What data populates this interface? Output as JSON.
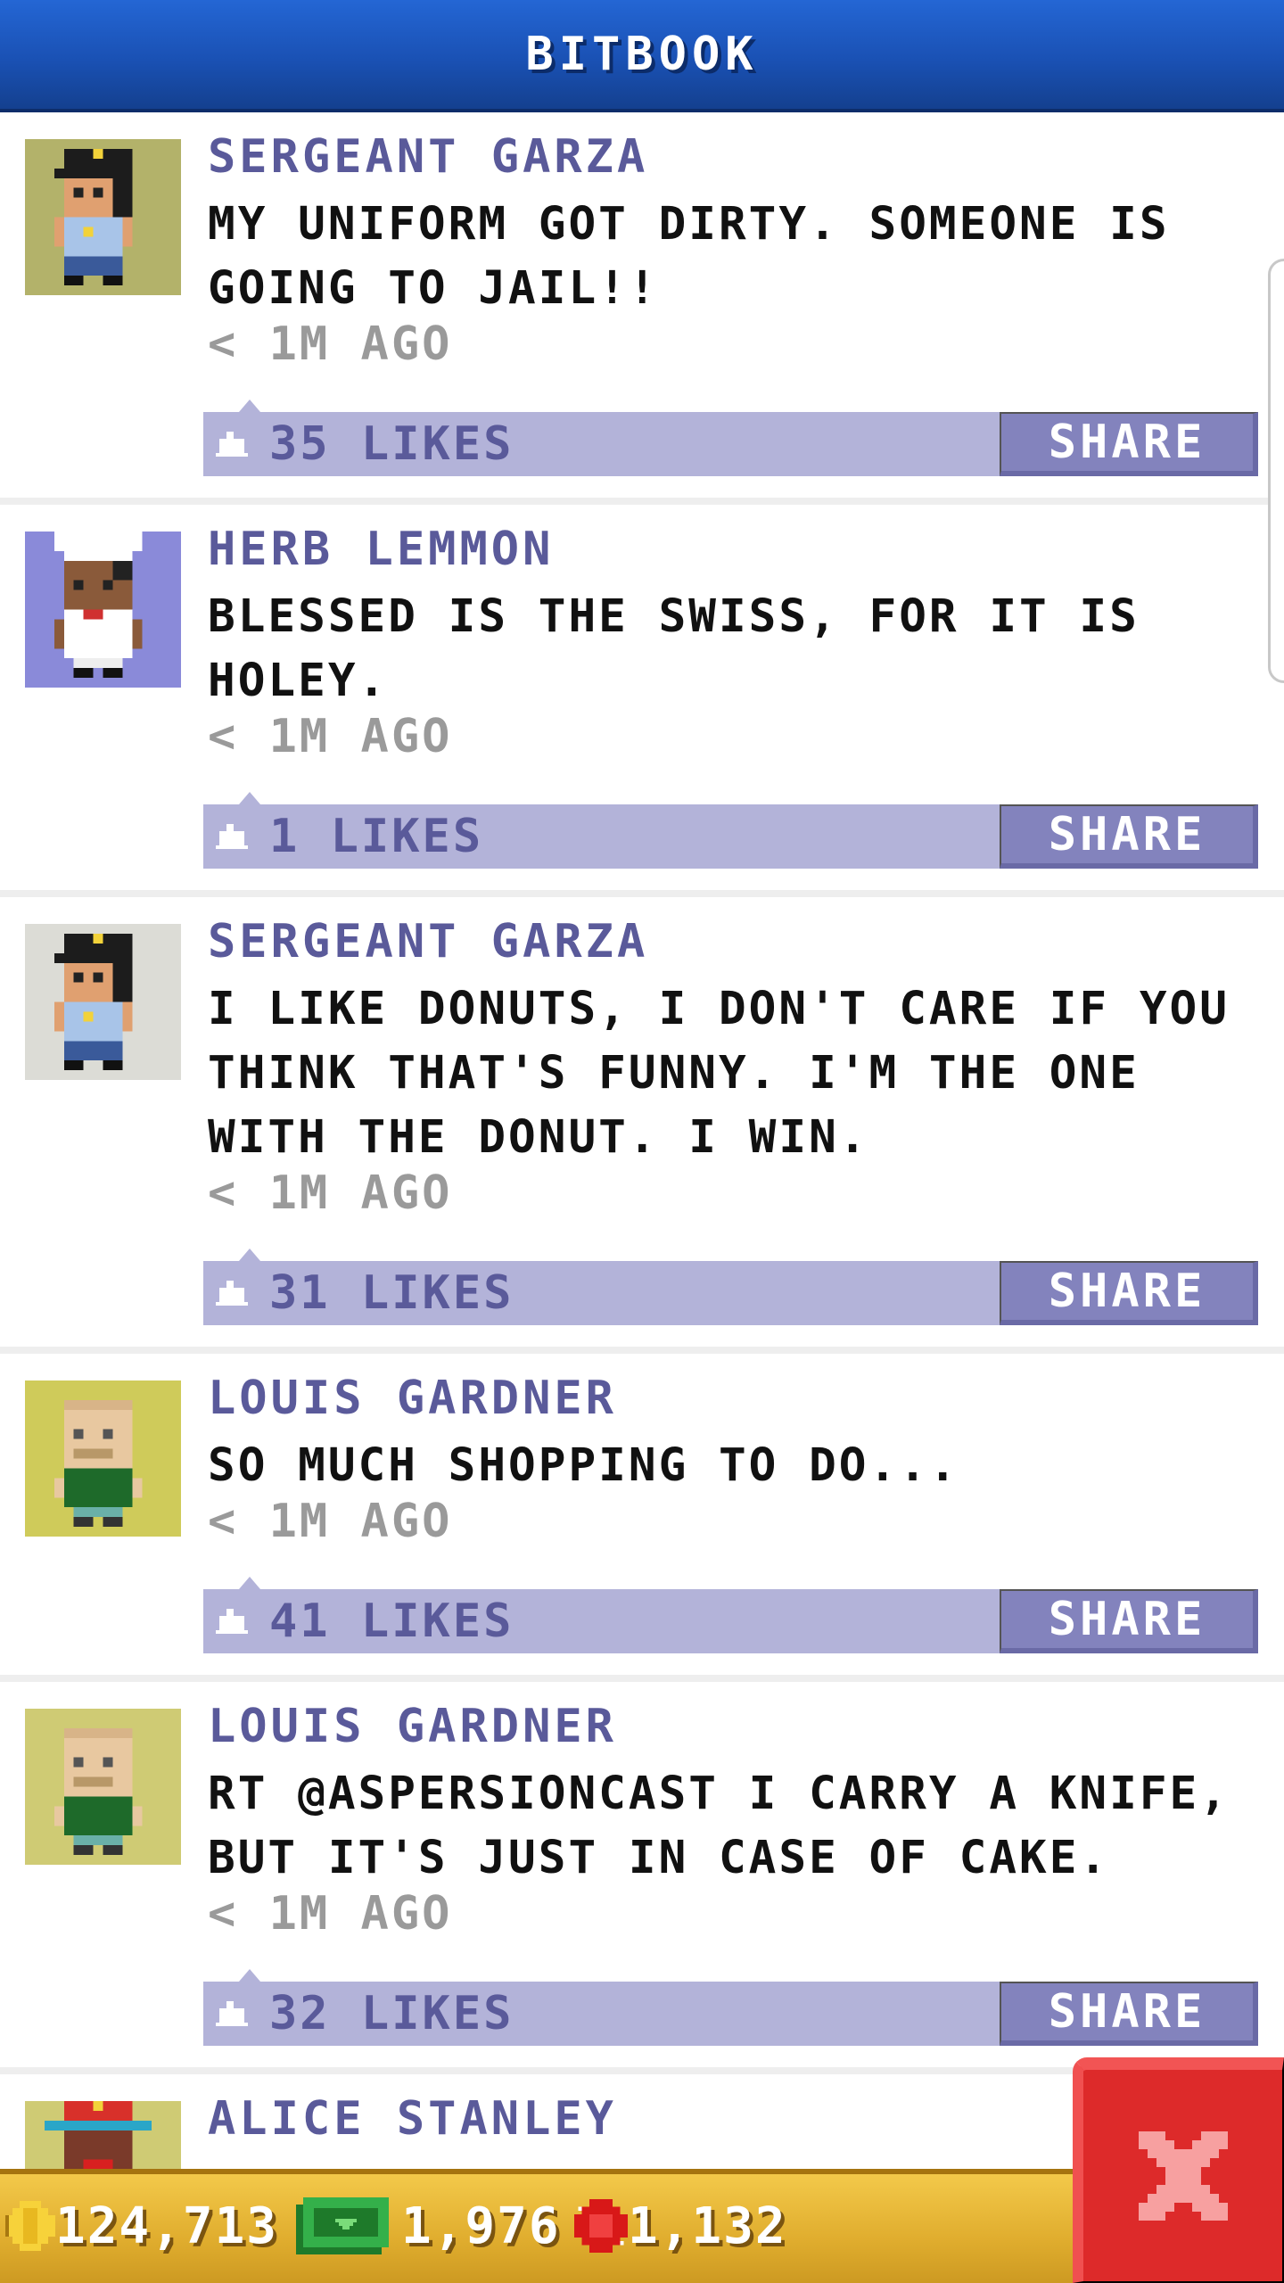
{
  "header": {
    "title": "BITBOOK"
  },
  "posts": [
    {
      "name": "SERGEANT GARZA",
      "avatar": "police-officer-avatar",
      "avatar_bg": "#b3b26a",
      "text": "MY UNIFORM GOT DIRTY. SOMEONE IS GOING TO JAIL!!",
      "time": "< 1M AGO",
      "likes": "35 LIKES",
      "share_label": "SHARE"
    },
    {
      "name": "HERB LEMMON",
      "avatar": "chef-avatar",
      "avatar_bg": "#8a8ad9",
      "text": "BLESSED IS THE SWISS, FOR IT IS HOLEY.",
      "time": "< 1M AGO",
      "likes": "1 LIKES",
      "share_label": "SHARE"
    },
    {
      "name": "SERGEANT GARZA",
      "avatar": "police-officer-avatar",
      "avatar_bg": "#dcdcd6",
      "text": "I LIKE DONUTS, I DON'T CARE IF YOU THINK THAT'S FUNNY. I'M THE ONE WITH THE DONUT. I WIN.",
      "time": "< 1M AGO",
      "likes": "31 LIKES",
      "share_label": "SHARE"
    },
    {
      "name": "LOUIS GARDNER",
      "avatar": "bald-man-avatar",
      "avatar_bg": "#cfcb5a",
      "text": "SO MUCH SHOPPING TO DO...",
      "time": "< 1M AGO",
      "likes": "41 LIKES",
      "share_label": "SHARE"
    },
    {
      "name": "LOUIS GARDNER",
      "avatar": "bald-man-avatar",
      "avatar_bg": "#cfcb74",
      "text": "RT @ASPERSIONCAST I CARRY A KNIFE, BUT IT'S JUST IN CASE OF CAKE.",
      "time": "< 1M AGO",
      "likes": "32 LIKES",
      "share_label": "SHARE"
    },
    {
      "name": "ALICE STANLEY",
      "avatar": "hat-woman-avatar",
      "avatar_bg": "#cfcb74",
      "text": "",
      "time": "",
      "likes": "",
      "share_label": ""
    }
  ],
  "bottom_bar": {
    "coins": "124,713",
    "bux": "1,976",
    "tickets": "1,132"
  },
  "colors": {
    "header_blue": "#1a51b4",
    "name_purple": "#5a5a9a",
    "like_bar": "#b3b3d9",
    "share_button": "#8383bd",
    "close_red": "#dd2a2a",
    "bottom_gold": "#e0ad2e"
  },
  "close_button": {
    "icon": "close-x-icon"
  }
}
